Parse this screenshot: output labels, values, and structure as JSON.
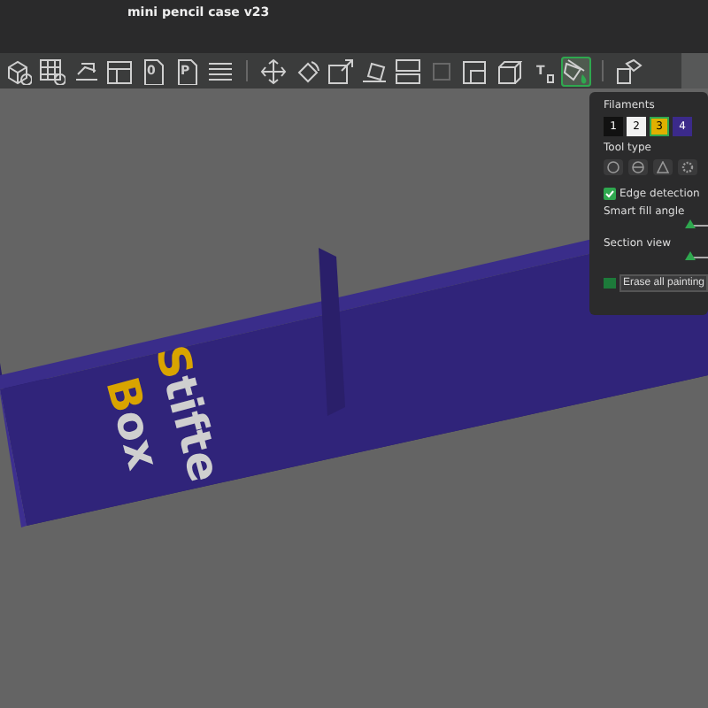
{
  "window": {
    "title": "mini pencil case v23"
  },
  "toolbar": [
    {
      "kind": "add-cube",
      "selected": false,
      "disabled": false
    },
    {
      "kind": "add-grid",
      "selected": false,
      "disabled": false
    },
    {
      "kind": "arrange",
      "selected": false,
      "disabled": false
    },
    {
      "kind": "layout",
      "selected": false,
      "disabled": false
    },
    {
      "kind": "doc",
      "label": "0",
      "selected": false,
      "disabled": false
    },
    {
      "kind": "doc",
      "label": "P",
      "selected": false,
      "disabled": false
    },
    {
      "kind": "lines",
      "selected": false,
      "disabled": false
    },
    {
      "kind": "separator"
    },
    {
      "kind": "move",
      "selected": false,
      "disabled": false
    },
    {
      "kind": "rotate",
      "selected": false,
      "disabled": false
    },
    {
      "kind": "scale",
      "selected": false,
      "disabled": false
    },
    {
      "kind": "lay-flat",
      "selected": false,
      "disabled": false
    },
    {
      "kind": "split",
      "selected": false,
      "disabled": false
    },
    {
      "kind": "blank",
      "selected": false,
      "disabled": true
    },
    {
      "kind": "cut",
      "selected": false,
      "disabled": false
    },
    {
      "kind": "cube",
      "selected": false,
      "disabled": false
    },
    {
      "kind": "text",
      "label": "T",
      "selected": false,
      "disabled": false
    },
    {
      "kind": "paint",
      "selected": true,
      "disabled": false
    },
    {
      "kind": "separator"
    },
    {
      "kind": "assembly",
      "selected": false,
      "disabled": false
    }
  ],
  "model_lettering": [
    {
      "parts": [
        {
          "text": "S",
          "color": "#d9a400"
        },
        {
          "text": "tifte",
          "color": "#cfcfcf"
        }
      ]
    },
    {
      "parts": [
        {
          "text": "B",
          "color": "#d9a400"
        },
        {
          "text": "ox",
          "color": "#cfcfcf"
        }
      ]
    }
  ],
  "paint_panel": {
    "filaments_label": "Filaments",
    "filaments": [
      {
        "label": "1",
        "color": "#111111",
        "selected": false
      },
      {
        "label": "2",
        "color": "#f2f2f2",
        "selected": false
      },
      {
        "label": "3",
        "color": "#e0b000",
        "selected": true
      },
      {
        "label": "4",
        "color": "#3b2a8a",
        "selected": false
      }
    ],
    "tool_type_label": "Tool type",
    "tools": [
      {
        "kind": "circle"
      },
      {
        "kind": "sphere"
      },
      {
        "kind": "triangle"
      },
      {
        "kind": "gap-fill"
      }
    ],
    "edge_detection": {
      "label": "Edge detection",
      "checked": true
    },
    "sliders": [
      {
        "label": "Smart fill angle",
        "level": 0
      },
      {
        "label": "Section view",
        "level": 0
      }
    ],
    "erase_button": "Erase all painting"
  }
}
